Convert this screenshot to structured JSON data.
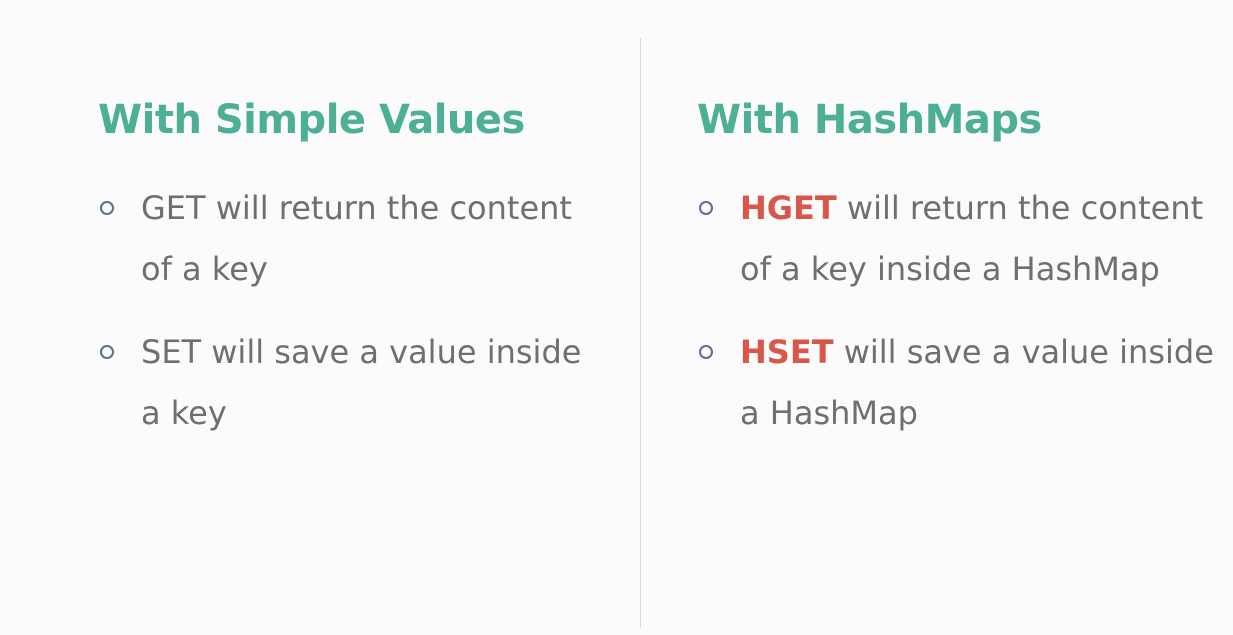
{
  "left": {
    "heading": "With Simple Values",
    "items": [
      {
        "text": "GET will return the content of a key"
      },
      {
        "text": "SET will save a value inside a key"
      }
    ]
  },
  "right": {
    "heading": "With HashMaps",
    "items": [
      {
        "keyword": "HGET",
        "text": " will return the content of a key inside a HashMap"
      },
      {
        "keyword": "HSET",
        "text": " will save a value inside a HashMap"
      }
    ]
  },
  "colors": {
    "heading": "#4caf96",
    "body_text": "#6f6f6f",
    "keyword": "#d9574a",
    "bullet_marker": "#5b6b9a",
    "divider": "#d9d9d9",
    "background": "#fbfbfb"
  },
  "icons": {
    "bullet": "hollow-circle-icon"
  }
}
